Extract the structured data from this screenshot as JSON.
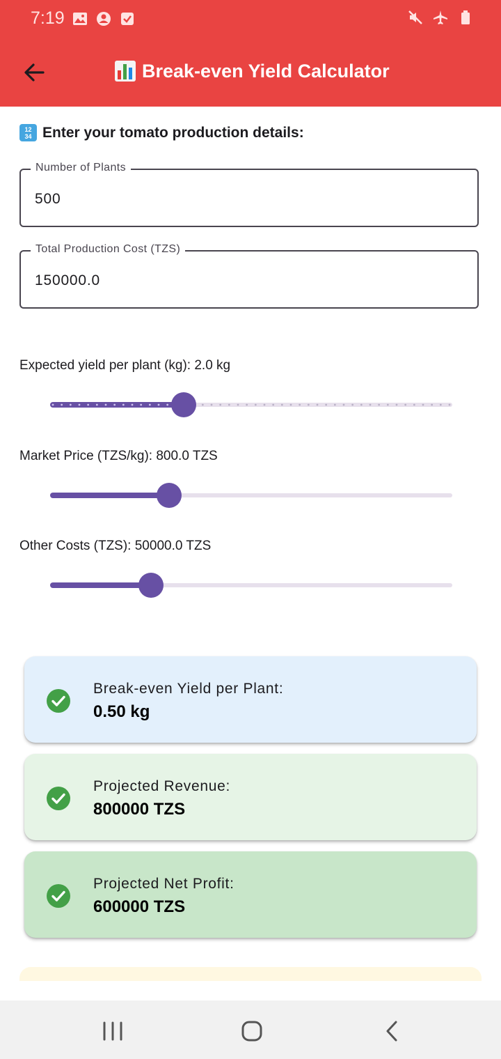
{
  "status_bar": {
    "time": "7:19",
    "left_icons": [
      "image-icon",
      "account-circle-icon",
      "checkbox-icon"
    ],
    "right_icons": [
      "mute-icon",
      "airplane-mode-icon",
      "battery-icon"
    ]
  },
  "app_bar": {
    "title": "Break-even Yield Calculator",
    "title_icon": "bar-chart-emoji-icon",
    "back_icon": "back-arrow-icon",
    "background": "#e94442"
  },
  "form": {
    "heading": "Enter your tomato production details:",
    "heading_icon": "input-numbers-emoji-icon",
    "plants": {
      "label": "Number of Plants",
      "value": "500"
    },
    "cost": {
      "label": "Total Production Cost (TZS)",
      "value": "150000.0"
    }
  },
  "sliders": [
    {
      "label": "Expected yield per plant (kg): 2.0 kg",
      "fraction": 0.333,
      "discrete": true
    },
    {
      "label": "Market Price (TZS/kg): 800.0 TZS",
      "fraction": 0.295,
      "discrete": false
    },
    {
      "label": "Other Costs (TZS): 50000.0 TZS",
      "fraction": 0.25,
      "discrete": false
    }
  ],
  "results": [
    {
      "title": "Break-even Yield per Plant:",
      "value": "0.50 kg",
      "background": "#e3f0fc"
    },
    {
      "title": "Projected Revenue:",
      "value": "800000 TZS",
      "background": "#e6f4e6"
    },
    {
      "title": "Projected Net Profit:",
      "value": "600000 TZS",
      "background": "#c8e6c9"
    }
  ],
  "colors": {
    "accent": "#6750a4",
    "success": "#43a047"
  },
  "nav_bar": {
    "icons": [
      "recent-apps-icon",
      "home-icon",
      "back-icon"
    ]
  }
}
